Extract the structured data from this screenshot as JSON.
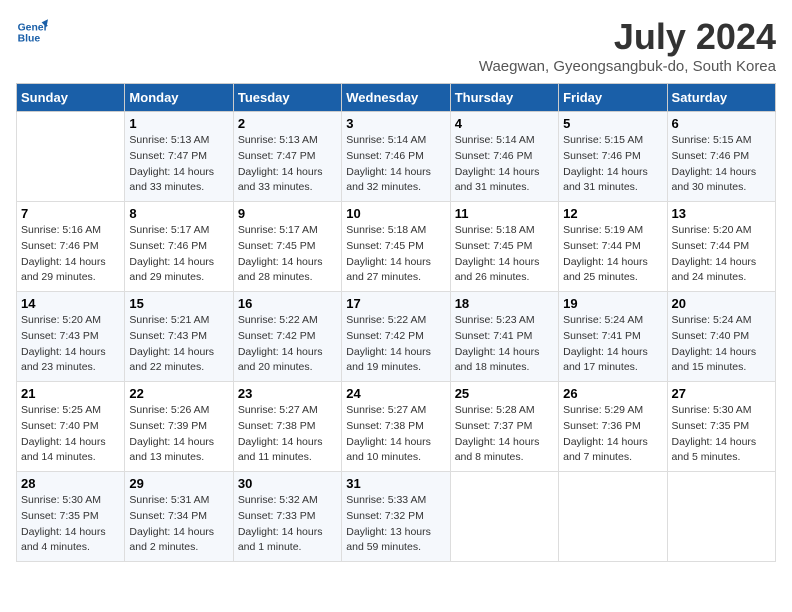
{
  "logo": {
    "line1": "General",
    "line2": "Blue"
  },
  "title": "July 2024",
  "subtitle": "Waegwan, Gyeongsangbuk-do, South Korea",
  "headers": [
    "Sunday",
    "Monday",
    "Tuesday",
    "Wednesday",
    "Thursday",
    "Friday",
    "Saturday"
  ],
  "weeks": [
    [
      {
        "day": "",
        "info": ""
      },
      {
        "day": "1",
        "info": "Sunrise: 5:13 AM\nSunset: 7:47 PM\nDaylight: 14 hours\nand 33 minutes."
      },
      {
        "day": "2",
        "info": "Sunrise: 5:13 AM\nSunset: 7:47 PM\nDaylight: 14 hours\nand 33 minutes."
      },
      {
        "day": "3",
        "info": "Sunrise: 5:14 AM\nSunset: 7:46 PM\nDaylight: 14 hours\nand 32 minutes."
      },
      {
        "day": "4",
        "info": "Sunrise: 5:14 AM\nSunset: 7:46 PM\nDaylight: 14 hours\nand 31 minutes."
      },
      {
        "day": "5",
        "info": "Sunrise: 5:15 AM\nSunset: 7:46 PM\nDaylight: 14 hours\nand 31 minutes."
      },
      {
        "day": "6",
        "info": "Sunrise: 5:15 AM\nSunset: 7:46 PM\nDaylight: 14 hours\nand 30 minutes."
      }
    ],
    [
      {
        "day": "7",
        "info": "Sunrise: 5:16 AM\nSunset: 7:46 PM\nDaylight: 14 hours\nand 29 minutes."
      },
      {
        "day": "8",
        "info": "Sunrise: 5:17 AM\nSunset: 7:46 PM\nDaylight: 14 hours\nand 29 minutes."
      },
      {
        "day": "9",
        "info": "Sunrise: 5:17 AM\nSunset: 7:45 PM\nDaylight: 14 hours\nand 28 minutes."
      },
      {
        "day": "10",
        "info": "Sunrise: 5:18 AM\nSunset: 7:45 PM\nDaylight: 14 hours\nand 27 minutes."
      },
      {
        "day": "11",
        "info": "Sunrise: 5:18 AM\nSunset: 7:45 PM\nDaylight: 14 hours\nand 26 minutes."
      },
      {
        "day": "12",
        "info": "Sunrise: 5:19 AM\nSunset: 7:44 PM\nDaylight: 14 hours\nand 25 minutes."
      },
      {
        "day": "13",
        "info": "Sunrise: 5:20 AM\nSunset: 7:44 PM\nDaylight: 14 hours\nand 24 minutes."
      }
    ],
    [
      {
        "day": "14",
        "info": "Sunrise: 5:20 AM\nSunset: 7:43 PM\nDaylight: 14 hours\nand 23 minutes."
      },
      {
        "day": "15",
        "info": "Sunrise: 5:21 AM\nSunset: 7:43 PM\nDaylight: 14 hours\nand 22 minutes."
      },
      {
        "day": "16",
        "info": "Sunrise: 5:22 AM\nSunset: 7:42 PM\nDaylight: 14 hours\nand 20 minutes."
      },
      {
        "day": "17",
        "info": "Sunrise: 5:22 AM\nSunset: 7:42 PM\nDaylight: 14 hours\nand 19 minutes."
      },
      {
        "day": "18",
        "info": "Sunrise: 5:23 AM\nSunset: 7:41 PM\nDaylight: 14 hours\nand 18 minutes."
      },
      {
        "day": "19",
        "info": "Sunrise: 5:24 AM\nSunset: 7:41 PM\nDaylight: 14 hours\nand 17 minutes."
      },
      {
        "day": "20",
        "info": "Sunrise: 5:24 AM\nSunset: 7:40 PM\nDaylight: 14 hours\nand 15 minutes."
      }
    ],
    [
      {
        "day": "21",
        "info": "Sunrise: 5:25 AM\nSunset: 7:40 PM\nDaylight: 14 hours\nand 14 minutes."
      },
      {
        "day": "22",
        "info": "Sunrise: 5:26 AM\nSunset: 7:39 PM\nDaylight: 14 hours\nand 13 minutes."
      },
      {
        "day": "23",
        "info": "Sunrise: 5:27 AM\nSunset: 7:38 PM\nDaylight: 14 hours\nand 11 minutes."
      },
      {
        "day": "24",
        "info": "Sunrise: 5:27 AM\nSunset: 7:38 PM\nDaylight: 14 hours\nand 10 minutes."
      },
      {
        "day": "25",
        "info": "Sunrise: 5:28 AM\nSunset: 7:37 PM\nDaylight: 14 hours\nand 8 minutes."
      },
      {
        "day": "26",
        "info": "Sunrise: 5:29 AM\nSunset: 7:36 PM\nDaylight: 14 hours\nand 7 minutes."
      },
      {
        "day": "27",
        "info": "Sunrise: 5:30 AM\nSunset: 7:35 PM\nDaylight: 14 hours\nand 5 minutes."
      }
    ],
    [
      {
        "day": "28",
        "info": "Sunrise: 5:30 AM\nSunset: 7:35 PM\nDaylight: 14 hours\nand 4 minutes."
      },
      {
        "day": "29",
        "info": "Sunrise: 5:31 AM\nSunset: 7:34 PM\nDaylight: 14 hours\nand 2 minutes."
      },
      {
        "day": "30",
        "info": "Sunrise: 5:32 AM\nSunset: 7:33 PM\nDaylight: 14 hours\nand 1 minute."
      },
      {
        "day": "31",
        "info": "Sunrise: 5:33 AM\nSunset: 7:32 PM\nDaylight: 13 hours\nand 59 minutes."
      },
      {
        "day": "",
        "info": ""
      },
      {
        "day": "",
        "info": ""
      },
      {
        "day": "",
        "info": ""
      }
    ]
  ]
}
